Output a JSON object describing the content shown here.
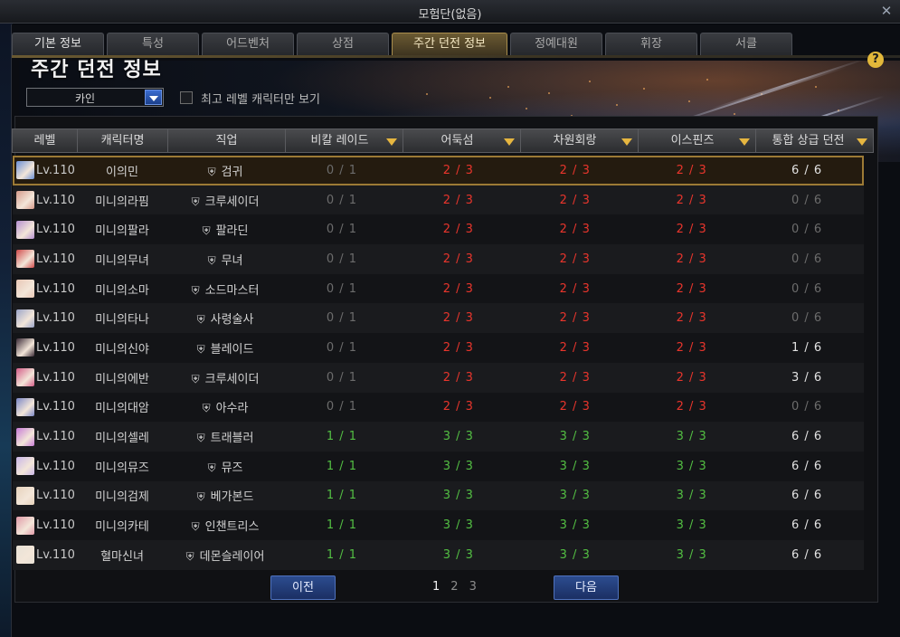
{
  "window": {
    "title": "모험단(없음)"
  },
  "tabs": [
    "기본 정보",
    "특성",
    "어드벤처",
    "상점",
    "주간 던전 정보",
    "정예대원",
    "휘장",
    "서클"
  ],
  "active_tab": "주간 던전 정보",
  "page": {
    "title": "주간 던전 정보",
    "help_label": "?"
  },
  "filter": {
    "server": "카인",
    "only_top_level_label": "최고 레벨 캐릭터만 보기"
  },
  "table": {
    "headers": [
      "레벨",
      "캐릭터명",
      "직업",
      "비칼 레이드",
      "어둑섬",
      "차원회랑",
      "이스핀즈",
      "통합 상급 던전"
    ],
    "rows": [
      {
        "level": "Lv.110",
        "name": "이의민",
        "job": "검귀",
        "raid": "0 / 1",
        "dark": "2 / 3",
        "dim": "2 / 3",
        "isp": "2 / 3",
        "adv": "6 / 6",
        "c": [
          "gray",
          "red",
          "red",
          "red",
          "white"
        ],
        "avatar": "#6a8fd6"
      },
      {
        "level": "Lv.110",
        "name": "미니의라핌",
        "job": "크루세이더",
        "raid": "0 / 1",
        "dark": "2 / 3",
        "dim": "2 / 3",
        "isp": "2 / 3",
        "adv": "0 / 6",
        "c": [
          "gray",
          "red",
          "red",
          "red",
          "gray"
        ],
        "avatar": "#d69a8a"
      },
      {
        "level": "Lv.110",
        "name": "미니의팔라",
        "job": "팔라딘",
        "raid": "0 / 1",
        "dark": "2 / 3",
        "dim": "2 / 3",
        "isp": "2 / 3",
        "adv": "0 / 6",
        "c": [
          "gray",
          "red",
          "red",
          "red",
          "gray"
        ],
        "avatar": "#b58fd0"
      },
      {
        "level": "Lv.110",
        "name": "미니의무녀",
        "job": "무녀",
        "raid": "0 / 1",
        "dark": "2 / 3",
        "dim": "2 / 3",
        "isp": "2 / 3",
        "adv": "0 / 6",
        "c": [
          "gray",
          "red",
          "red",
          "red",
          "gray"
        ],
        "avatar": "#d04a4a"
      },
      {
        "level": "Lv.110",
        "name": "미니의소마",
        "job": "소드마스터",
        "raid": "0 / 1",
        "dark": "2 / 3",
        "dim": "2 / 3",
        "isp": "2 / 3",
        "adv": "0 / 6",
        "c": [
          "gray",
          "red",
          "red",
          "red",
          "gray"
        ],
        "avatar": "#e8c7b6"
      },
      {
        "level": "Lv.110",
        "name": "미니의타나",
        "job": "사령술사",
        "raid": "0 / 1",
        "dark": "2 / 3",
        "dim": "2 / 3",
        "isp": "2 / 3",
        "adv": "0 / 6",
        "c": [
          "gray",
          "red",
          "red",
          "red",
          "gray"
        ],
        "avatar": "#9aa4c8"
      },
      {
        "level": "Lv.110",
        "name": "미니의신야",
        "job": "블레이드",
        "raid": "0 / 1",
        "dark": "2 / 3",
        "dim": "2 / 3",
        "isp": "2 / 3",
        "adv": "1 / 6",
        "c": [
          "gray",
          "red",
          "red",
          "red",
          "white"
        ],
        "avatar": "#3a2a36"
      },
      {
        "level": "Lv.110",
        "name": "미니의에반",
        "job": "크루세이더",
        "raid": "0 / 1",
        "dark": "2 / 3",
        "dim": "2 / 3",
        "isp": "2 / 3",
        "adv": "3 / 6",
        "c": [
          "gray",
          "red",
          "red",
          "red",
          "white"
        ],
        "avatar": "#d45c88"
      },
      {
        "level": "Lv.110",
        "name": "미니의대암",
        "job": "아수라",
        "raid": "0 / 1",
        "dark": "2 / 3",
        "dim": "2 / 3",
        "isp": "2 / 3",
        "adv": "0 / 6",
        "c": [
          "gray",
          "red",
          "red",
          "red",
          "gray"
        ],
        "avatar": "#7a86c6"
      },
      {
        "level": "Lv.110",
        "name": "미니의셀레",
        "job": "트래블러",
        "raid": "1 / 1",
        "dark": "3 / 3",
        "dim": "3 / 3",
        "isp": "3 / 3",
        "adv": "6 / 6",
        "c": [
          "green",
          "green",
          "green",
          "green",
          "white"
        ],
        "avatar": "#c77ad6"
      },
      {
        "level": "Lv.110",
        "name": "미니의뮤즈",
        "job": "뮤즈",
        "raid": "1 / 1",
        "dark": "3 / 3",
        "dim": "3 / 3",
        "isp": "3 / 3",
        "adv": "6 / 6",
        "c": [
          "green",
          "green",
          "green",
          "green",
          "white"
        ],
        "avatar": "#c9b6e8"
      },
      {
        "level": "Lv.110",
        "name": "미니의검제",
        "job": "베가본드",
        "raid": "1 / 1",
        "dark": "3 / 3",
        "dim": "3 / 3",
        "isp": "3 / 3",
        "adv": "6 / 6",
        "c": [
          "green",
          "green",
          "green",
          "green",
          "white"
        ],
        "avatar": "#e6d2bc"
      },
      {
        "level": "Lv.110",
        "name": "미니의카테",
        "job": "인챈트리스",
        "raid": "1 / 1",
        "dark": "3 / 3",
        "dim": "3 / 3",
        "isp": "3 / 3",
        "adv": "6 / 6",
        "c": [
          "green",
          "green",
          "green",
          "green",
          "white"
        ],
        "avatar": "#e09aa8"
      },
      {
        "level": "Lv.110",
        "name": "혈마신녀",
        "job": "데몬슬레이어",
        "raid": "1 / 1",
        "dark": "3 / 3",
        "dim": "3 / 3",
        "isp": "3 / 3",
        "adv": "6 / 6",
        "c": [
          "green",
          "green",
          "green",
          "green",
          "white"
        ],
        "avatar": "#e8e2d6"
      }
    ]
  },
  "pager": {
    "prev_label": "이전",
    "next_label": "다음",
    "pages": [
      "1",
      "2",
      "3"
    ],
    "current": "1"
  },
  "colors": {
    "cleared": "#53bf43",
    "partial": "#e8352c",
    "none": "#6c6c6c",
    "accent": "#e6b640"
  }
}
